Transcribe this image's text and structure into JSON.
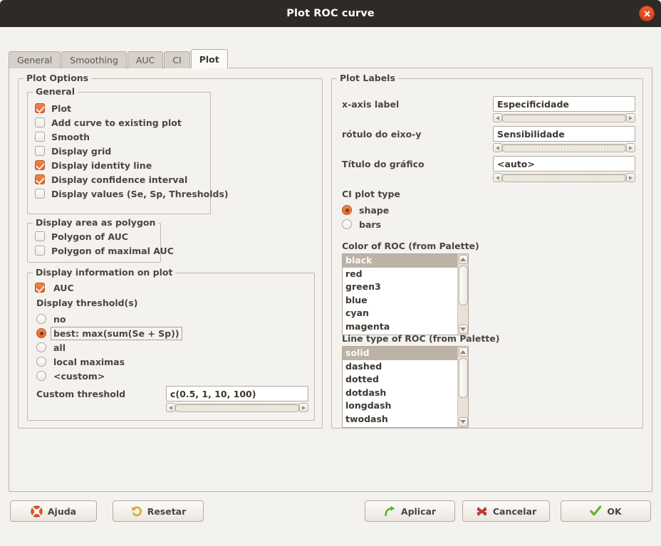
{
  "window": {
    "title": "Plot ROC curve",
    "close_icon": "close-icon"
  },
  "tabs": [
    {
      "label": "General",
      "active": false
    },
    {
      "label": "Smoothing",
      "active": false
    },
    {
      "label": "AUC",
      "active": false
    },
    {
      "label": "CI",
      "active": false
    },
    {
      "label": "Plot",
      "active": true
    }
  ],
  "plot_options": {
    "legend": "Plot Options",
    "general": {
      "legend": "General",
      "items": [
        {
          "label": "Plot",
          "checked": true
        },
        {
          "label": "Add curve to existing plot",
          "checked": false
        },
        {
          "label": "Smooth",
          "checked": false
        },
        {
          "label": "Display grid",
          "checked": false
        },
        {
          "label": "Display identity line",
          "checked": true
        },
        {
          "label": "Display confidence interval",
          "checked": true
        },
        {
          "label": "Display values (Se, Sp, Thresholds)",
          "checked": false
        }
      ]
    },
    "polygon": {
      "legend": "Display area as polygon",
      "items": [
        {
          "label": "Polygon of AUC",
          "checked": false
        },
        {
          "label": "Polygon of maximal AUC",
          "checked": false
        }
      ]
    },
    "info": {
      "legend": "Display information on plot",
      "auc": {
        "label": "AUC",
        "checked": true
      },
      "threshold_label": "Display threshold(s)",
      "threshold_options": [
        {
          "label": "no",
          "selected": false,
          "focused": false
        },
        {
          "label": "best: max(sum(Se + Sp))",
          "selected": true,
          "focused": true
        },
        {
          "label": "all",
          "selected": false,
          "focused": false
        },
        {
          "label": "local maximas",
          "selected": false,
          "focused": false
        },
        {
          "label": "<custom>",
          "selected": false,
          "focused": false
        }
      ],
      "custom_threshold_label": "Custom threshold",
      "custom_threshold_value": "c(0.5, 1, 10, 100)"
    }
  },
  "plot_labels": {
    "legend": "Plot Labels",
    "fields": [
      {
        "label": "x-axis label",
        "value": "Especificidade"
      },
      {
        "label": "rótulo do eixo-y",
        "value": "Sensibilidade"
      },
      {
        "label": "Título do gráfico",
        "value": "<auto>"
      }
    ],
    "ci_plot_type": {
      "label": "CI plot type",
      "options": [
        {
          "label": "shape",
          "selected": true
        },
        {
          "label": "bars",
          "selected": false
        }
      ]
    },
    "color_list": {
      "label": "Color of ROC (from Palette)",
      "items": [
        "black",
        "red",
        "green3",
        "blue",
        "cyan",
        "magenta"
      ],
      "selected_index": 0
    },
    "linetype_list": {
      "label": "Line type of ROC (from Palette)",
      "items": [
        "solid",
        "dashed",
        "dotted",
        "dotdash",
        "longdash",
        "twodash"
      ],
      "selected_index": 0
    }
  },
  "buttons": [
    {
      "label": "Ajuda",
      "icon": "lifering-icon"
    },
    {
      "label": "Resetar",
      "icon": "undo-arrow-icon"
    },
    {
      "label": "Aplicar",
      "icon": "green-arrow-icon"
    },
    {
      "label": "Cancelar",
      "icon": "red-x-icon"
    },
    {
      "label": "OK",
      "icon": "green-check-icon"
    }
  ],
  "colors": {
    "accent": "#e4682c",
    "titlebar": "#2d2a28",
    "dialog_bg": "#f4f2ef",
    "border": "#bdb2a6"
  }
}
